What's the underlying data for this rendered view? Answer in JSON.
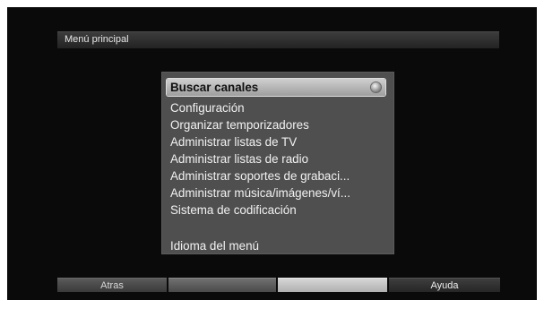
{
  "header": {
    "title": "Menú principal"
  },
  "menu": {
    "selected_index": 0,
    "items": [
      {
        "label": "Buscar canales"
      },
      {
        "label": "Configuración"
      },
      {
        "label": "Organizar temporizadores"
      },
      {
        "label": "Administrar listas de TV"
      },
      {
        "label": "Administrar listas de radio"
      },
      {
        "label": "Administrar soportes de grabaci..."
      },
      {
        "label": "Administrar música/imágenes/ví..."
      },
      {
        "label": "Sistema de codificación"
      },
      {
        "label": "Idioma del menú"
      }
    ]
  },
  "footer": {
    "buttons": [
      {
        "label": "Atras",
        "color": "#4a4a4a"
      },
      {
        "label": "",
        "color": "#5e5e5e"
      },
      {
        "label": "",
        "color": "#c4c4c4"
      },
      {
        "label": "Ayuda",
        "color": "#303030"
      }
    ]
  },
  "icons": {
    "selected_indicator": "ok-dot-icon"
  }
}
